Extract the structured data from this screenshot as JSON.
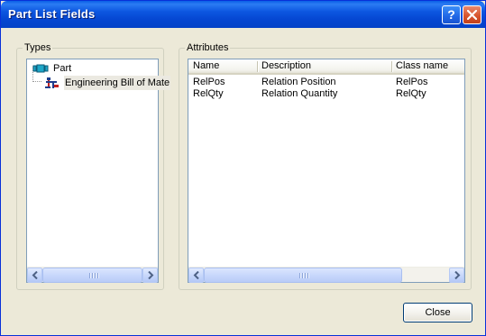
{
  "window": {
    "title": "Part List Fields"
  },
  "types": {
    "label": "Types",
    "items": [
      {
        "label": "Part",
        "icon": "part-icon"
      },
      {
        "label": "Engineering Bill of Mate",
        "icon": "engineering-bom-icon"
      }
    ]
  },
  "attributes": {
    "label": "Attributes",
    "columns": [
      "Name",
      "Description",
      "Class name"
    ],
    "rows": [
      {
        "name": "RelPos",
        "description": "Relation Position",
        "class_name": "RelPos"
      },
      {
        "name": "RelQty",
        "description": "Relation Quantity",
        "class_name": "RelQty"
      }
    ]
  },
  "buttons": {
    "close": "Close"
  },
  "colors": {
    "titlebar": "#0546d1",
    "window_bg": "#ece9d8",
    "selection_bg": "#ebe9e1"
  }
}
